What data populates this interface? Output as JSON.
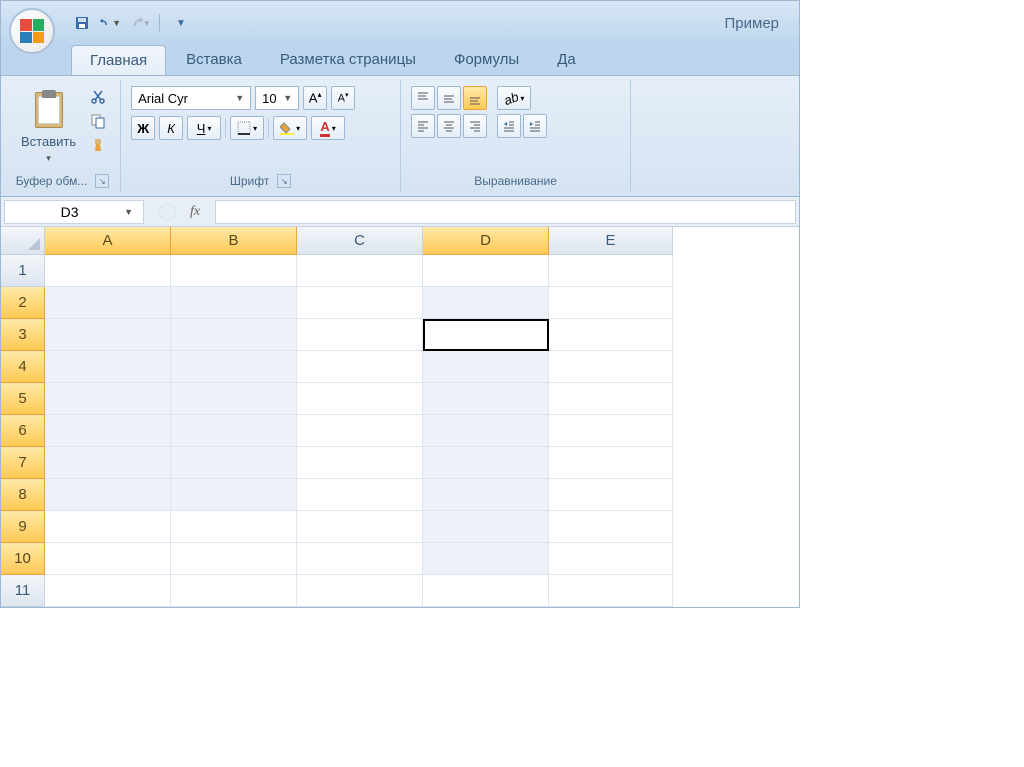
{
  "titlebar": {
    "document_title": "Пример"
  },
  "ribbon": {
    "tabs": [
      "Главная",
      "Вставка",
      "Разметка страницы",
      "Формулы",
      "Да"
    ],
    "active_tab": 0,
    "clipboard": {
      "paste_label": "Вставить",
      "group_label": "Буфер обм..."
    },
    "font": {
      "name": "Arial Cyr",
      "size": "10",
      "bold": "Ж",
      "italic": "К",
      "underline": "Ч",
      "group_label": "Шрифт"
    },
    "alignment": {
      "group_label": "Выравнивание"
    }
  },
  "formula_bar": {
    "name_box": "D3",
    "fx_label": "fx"
  },
  "grid": {
    "columns": [
      "A",
      "B",
      "C",
      "D",
      "E"
    ],
    "selected_columns": [
      "A",
      "B",
      "D"
    ],
    "rows": [
      "1",
      "2",
      "3",
      "4",
      "5",
      "6",
      "7",
      "8",
      "9",
      "10",
      "11"
    ],
    "selected_rows": [
      "2",
      "3",
      "4",
      "5",
      "6",
      "7",
      "8",
      "9",
      "10"
    ],
    "active_cell": "D3",
    "range_cells": [
      "A2",
      "B2",
      "D2",
      "A3",
      "B3",
      "A4",
      "B4",
      "D4",
      "A5",
      "B5",
      "D5",
      "A6",
      "B6",
      "D6",
      "A7",
      "B7",
      "D7",
      "A8",
      "B8",
      "D8",
      "D9",
      "D10"
    ]
  }
}
